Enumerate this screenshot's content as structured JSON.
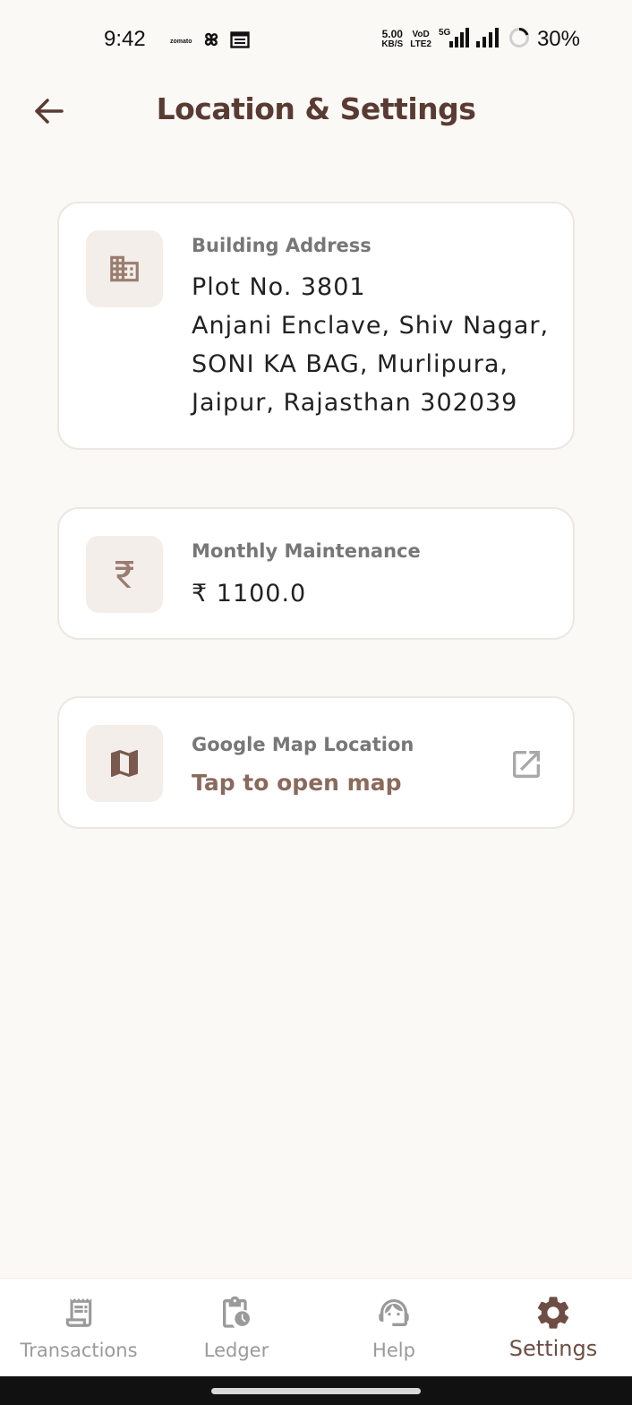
{
  "status_bar": {
    "time": "9:42",
    "zomato_label": "zomato",
    "net_speed_value": "5.00",
    "net_speed_unit": "KB/S",
    "volte_top": "VoD",
    "volte_bottom": "LTE2",
    "network_5g": "5G",
    "battery_percent": "30%"
  },
  "header": {
    "title": "Location & Settings",
    "back_icon": "arrow-left-icon"
  },
  "address_card": {
    "icon": "building-icon",
    "label": "Building Address",
    "lines": [
      "Plot No. 3801",
      "Anjani Enclave, Shiv Nagar,",
      "SONI KA BAG, Murlipura,",
      "Jaipur, Rajasthan 302039"
    ]
  },
  "maintenance_card": {
    "icon": "rupee-icon",
    "label": "Monthly Maintenance",
    "value": "₹ 1100.0"
  },
  "map_card": {
    "icon": "map-icon",
    "label": "Google Map Location",
    "link_text": "Tap to open map",
    "action_icon": "open-external-icon"
  },
  "bottom_nav": {
    "items": [
      {
        "label": "Transactions",
        "icon": "receipt-icon",
        "active": false
      },
      {
        "label": "Ledger",
        "icon": "clipboard-clock-icon",
        "active": false
      },
      {
        "label": "Help",
        "icon": "support-agent-icon",
        "active": false
      },
      {
        "label": "Settings",
        "icon": "gear-icon",
        "active": true
      }
    ]
  },
  "colors": {
    "background": "#fbf9f6",
    "title": "#5a3b33",
    "accent": "#8a6a5c",
    "icon_box": "#f3eeea",
    "nav_active": "#6e4e44",
    "nav_inactive": "#9a9a9a"
  }
}
